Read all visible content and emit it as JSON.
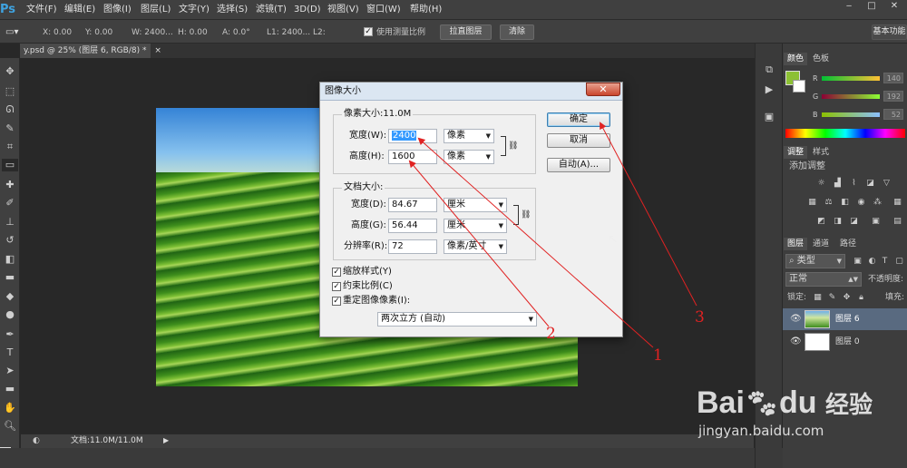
{
  "menubar": {
    "logo": "Ps",
    "items": [
      "文件(F)",
      "编辑(E)",
      "图像(I)",
      "图层(L)",
      "文字(Y)",
      "选择(S)",
      "滤镜(T)",
      "3D(D)",
      "视图(V)",
      "窗口(W)",
      "帮助(H)"
    ],
    "window_buttons": [
      "‒",
      "□",
      "✕"
    ]
  },
  "options": {
    "x": "X: 0.00",
    "y": "Y: 0.00",
    "w": "W: 2400...",
    "h": "H: 0.00",
    "a": "A: 0.0°",
    "l1": "L1: 2400...",
    "l2": "L2:",
    "use_scale_label": "使用测量比例",
    "straighten_label": "拉直图层",
    "clear_label": "清除",
    "workspace": "基本功能"
  },
  "document": {
    "tab_title": "y.psd @ 25% (图层 6, RGB/8) *",
    "tab_close": "×",
    "status": "文档:11.0M/11.0M"
  },
  "dialog": {
    "title": "图像大小",
    "close": "✕",
    "pixel_section": "像素大小:11.0M",
    "width_label": "宽度(W):",
    "width_value": "2400",
    "height_label": "高度(H):",
    "height_value": "1600",
    "pixel_unit": "像素",
    "doc_section": "文档大小:",
    "doc_width_label": "宽度(D):",
    "doc_width_value": "84.67",
    "doc_height_label": "高度(G):",
    "doc_height_value": "56.44",
    "cm_unit": "厘米",
    "res_label": "分辨率(R):",
    "res_value": "72",
    "res_unit": "像素/英寸",
    "scale_styles": "缩放样式(Y)",
    "constrain": "约束比例(C)",
    "resample": "重定图像像素(I):",
    "resample_method": "两次立方 (自动)",
    "ok": "确定",
    "cancel": "取消",
    "auto": "自动(A)..."
  },
  "panels": {
    "color_tabs": [
      "颜色",
      "色板"
    ],
    "r_label": "R",
    "g_label": "G",
    "b_label": "B",
    "r_value": "140",
    "g_value": "192",
    "b_value": "52",
    "adj_tabs": [
      "调整",
      "样式"
    ],
    "adj_title": "添加调整",
    "layers_tabs": [
      "图层",
      "通道",
      "路径"
    ],
    "kind_label": "类型",
    "blend_mode": "正常",
    "opacity_label": "不透明度:",
    "lock_label": "锁定:",
    "fill_label": "填充:",
    "layers": [
      {
        "name": "图层 6"
      },
      {
        "name": "图层 0"
      }
    ]
  },
  "annotations": [
    "1",
    "2",
    "3"
  ],
  "watermark": {
    "brand": "Bai",
    "brand2": "du",
    "cn": "经验",
    "url": "jingyan.baidu.com"
  },
  "colors": {
    "foreground": "#8cc034",
    "annotation": "#e02222"
  }
}
